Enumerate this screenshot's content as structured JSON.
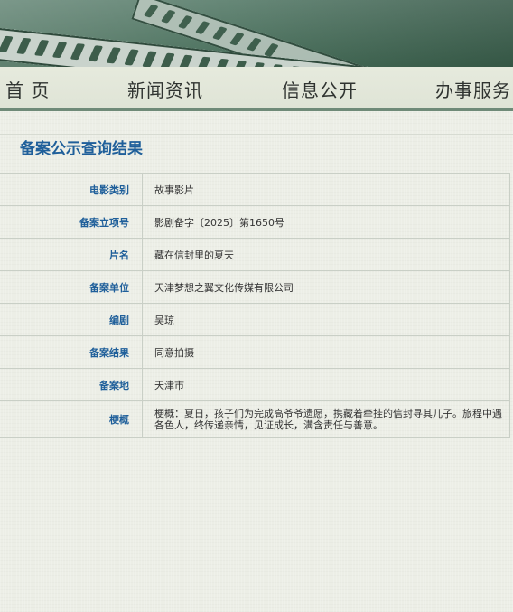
{
  "nav": {
    "items": [
      "首 页",
      "新闻资讯",
      "信息公开",
      "办事服务"
    ]
  },
  "page_title": "备案公示查询结果",
  "record": [
    {
      "label": "电影类别",
      "value": "故事影片"
    },
    {
      "label": "备案立项号",
      "value": "影剧备字〔2025〕第1650号"
    },
    {
      "label": "片名",
      "value": "藏在信封里的夏天"
    },
    {
      "label": "备案单位",
      "value": "天津梦想之翼文化传媒有限公司"
    },
    {
      "label": "编剧",
      "value": "吴琼"
    },
    {
      "label": "备案结果",
      "value": "同意拍摄"
    },
    {
      "label": "备案地",
      "value": "天津市"
    },
    {
      "label": "梗概",
      "value": "梗概：夏日，孩子们为完成高爷爷遗愿，携藏着牵挂的信封寻其儿子。旅程中遇各色人，终传递亲情，见证成长，满含责任与善意。"
    }
  ],
  "colors": {
    "label": "#1f5f9a",
    "banner": "#3d6550",
    "nav_bg": "#e2e6d9"
  }
}
